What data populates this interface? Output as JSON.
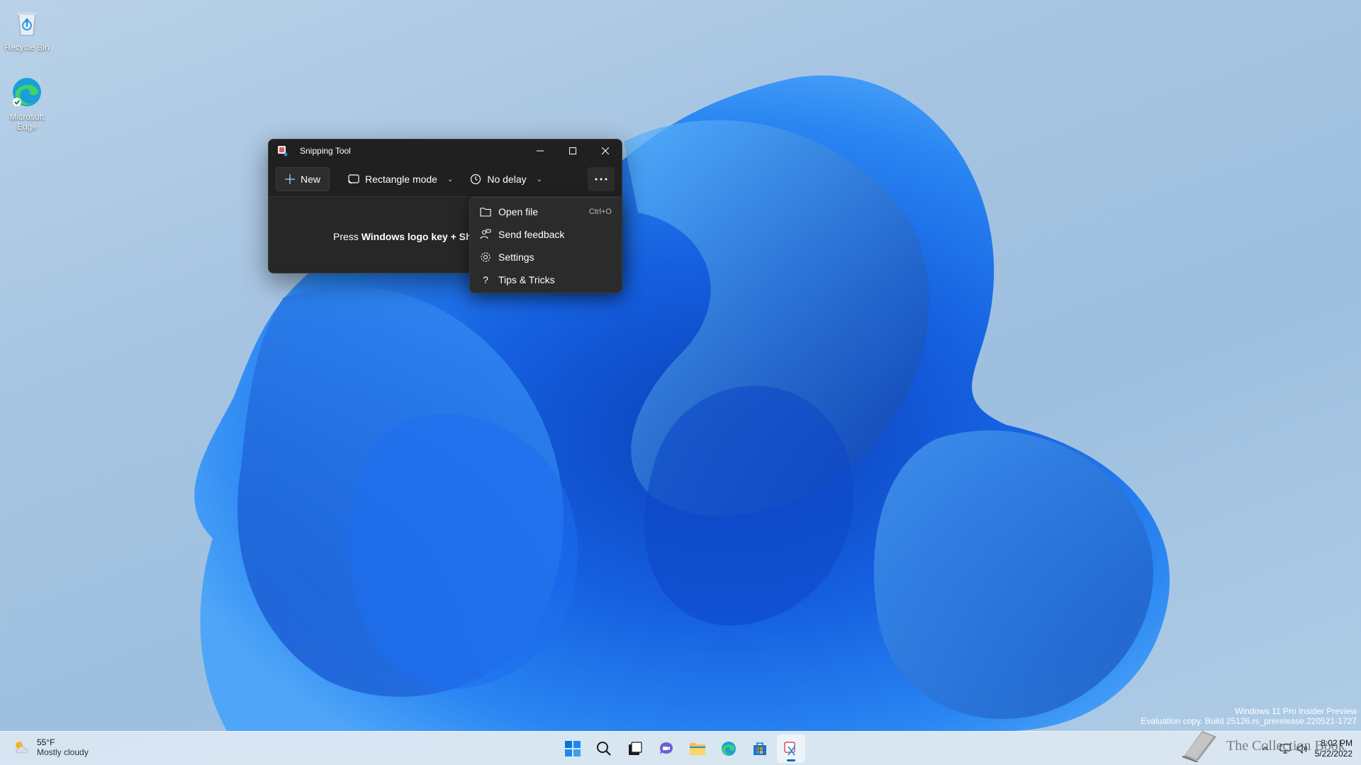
{
  "desktop": {
    "icons": [
      {
        "label": "Recycle Bin",
        "icon": "recycle-bin-icon"
      },
      {
        "label": "Microsoft Edge",
        "icon": "edge-icon"
      }
    ],
    "watermark_line1": "Windows 11 Pro Insider Preview",
    "watermark_line2": "Evaluation copy. Build 25126.rs_prerelease.220521-1727",
    "brand_overlay": "The Collection Book"
  },
  "snipping_tool": {
    "title": "Snipping Tool",
    "new_label": "New",
    "mode_label": "Rectangle mode",
    "delay_label": "No delay",
    "hint_prefix": "Press ",
    "hint_bold": "Windows logo key + Shi"
  },
  "more_menu": {
    "items": [
      {
        "label": "Open file",
        "shortcut": "Ctrl+O",
        "icon": "folder-icon"
      },
      {
        "label": "Send feedback",
        "icon": "feedback-icon"
      },
      {
        "label": "Settings",
        "icon": "gear-icon"
      },
      {
        "label": "Tips & Tricks",
        "icon": "question-icon"
      }
    ]
  },
  "taskbar": {
    "weather_temp": "55°F",
    "weather_condition": "Mostly cloudy",
    "time": "8:02 PM",
    "date": "5/22/2022",
    "apps": [
      "start-icon",
      "search-icon",
      "task-view-icon",
      "chat-icon",
      "file-explorer-icon",
      "edge-icon",
      "store-icon",
      "snipping-tool-icon"
    ]
  },
  "colors": {
    "accent": "#0067c0",
    "window_bg": "#202020",
    "menu_bg": "#2b2b2b"
  }
}
